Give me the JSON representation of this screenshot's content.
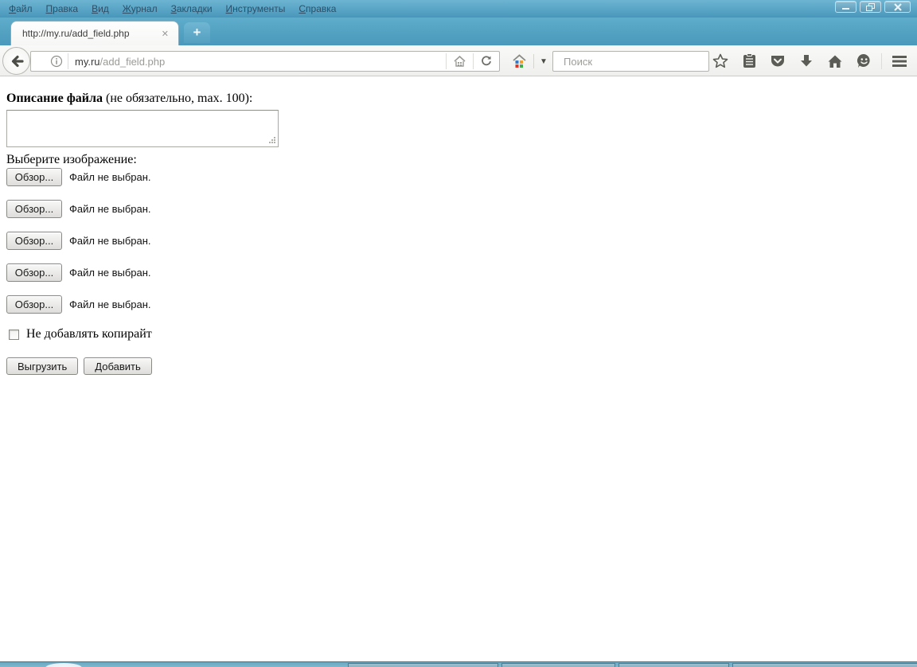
{
  "menu_bar": {
    "items": [
      {
        "accel": "Ф",
        "rest": "айл"
      },
      {
        "accel": "П",
        "rest": "равка"
      },
      {
        "accel": "В",
        "rest": "ид"
      },
      {
        "accel": "Ж",
        "rest": "урнал"
      },
      {
        "accel": "З",
        "rest": "акладки"
      },
      {
        "accel": "И",
        "rest": "нструменты"
      },
      {
        "accel": "С",
        "rest": "правка"
      }
    ]
  },
  "window_controls": {
    "icons": [
      "minimize-icon",
      "restore-icon",
      "close-icon"
    ]
  },
  "tab_bar": {
    "active_tab": {
      "title": "http://my.ru/add_field.php",
      "close_glyph": "✕"
    },
    "new_tab_glyph": "+"
  },
  "toolbar": {
    "icons": [
      "back-icon",
      "info-icon",
      "page-home-icon",
      "refresh-icon",
      "home-colored-icon",
      "dropdown-caret-icon",
      "search-icon",
      "star-icon",
      "bookmarks-list-icon",
      "pocket-icon",
      "download-icon",
      "home-icon",
      "chat-smiley-icon",
      "hamburger-menu-icon"
    ],
    "url_bar": {
      "host": "my.ru",
      "path": "/add_field.php"
    },
    "search": {
      "placeholder": "Поиск"
    },
    "caret_glyph": "▼"
  },
  "colors": {
    "chrome_teal_top": "#6cb4d1",
    "chrome_teal_bottom": "#4795b9",
    "toolbar_bg": "#f4f4f2",
    "menu_text": "#2d4e66",
    "house_dots": {
      "top_left": "#3a78c2",
      "top_right": "#f0a02e",
      "bottom_left": "#d9372a",
      "bottom_right": "#3fae49"
    }
  },
  "page": {
    "description_label": {
      "bold": "Описание файла",
      "rest": " (не обязательно, max. 100):"
    },
    "textarea_value": "",
    "choose_image_label": "Выберите изображение:",
    "file_rows": [
      {
        "browse_label": "Обзор...",
        "status": "Файл не выбран."
      },
      {
        "browse_label": "Обзор...",
        "status": "Файл не выбран."
      },
      {
        "browse_label": "Обзор...",
        "status": "Файл не выбран."
      },
      {
        "browse_label": "Обзор...",
        "status": "Файл не выбран."
      },
      {
        "browse_label": "Обзор...",
        "status": "Файл не выбран."
      }
    ],
    "copyright_checkbox": {
      "checked": false,
      "label": "Не добавлять копирайт"
    },
    "submit_buttons": {
      "upload": "Выгрузить",
      "add": "Добавить"
    }
  }
}
